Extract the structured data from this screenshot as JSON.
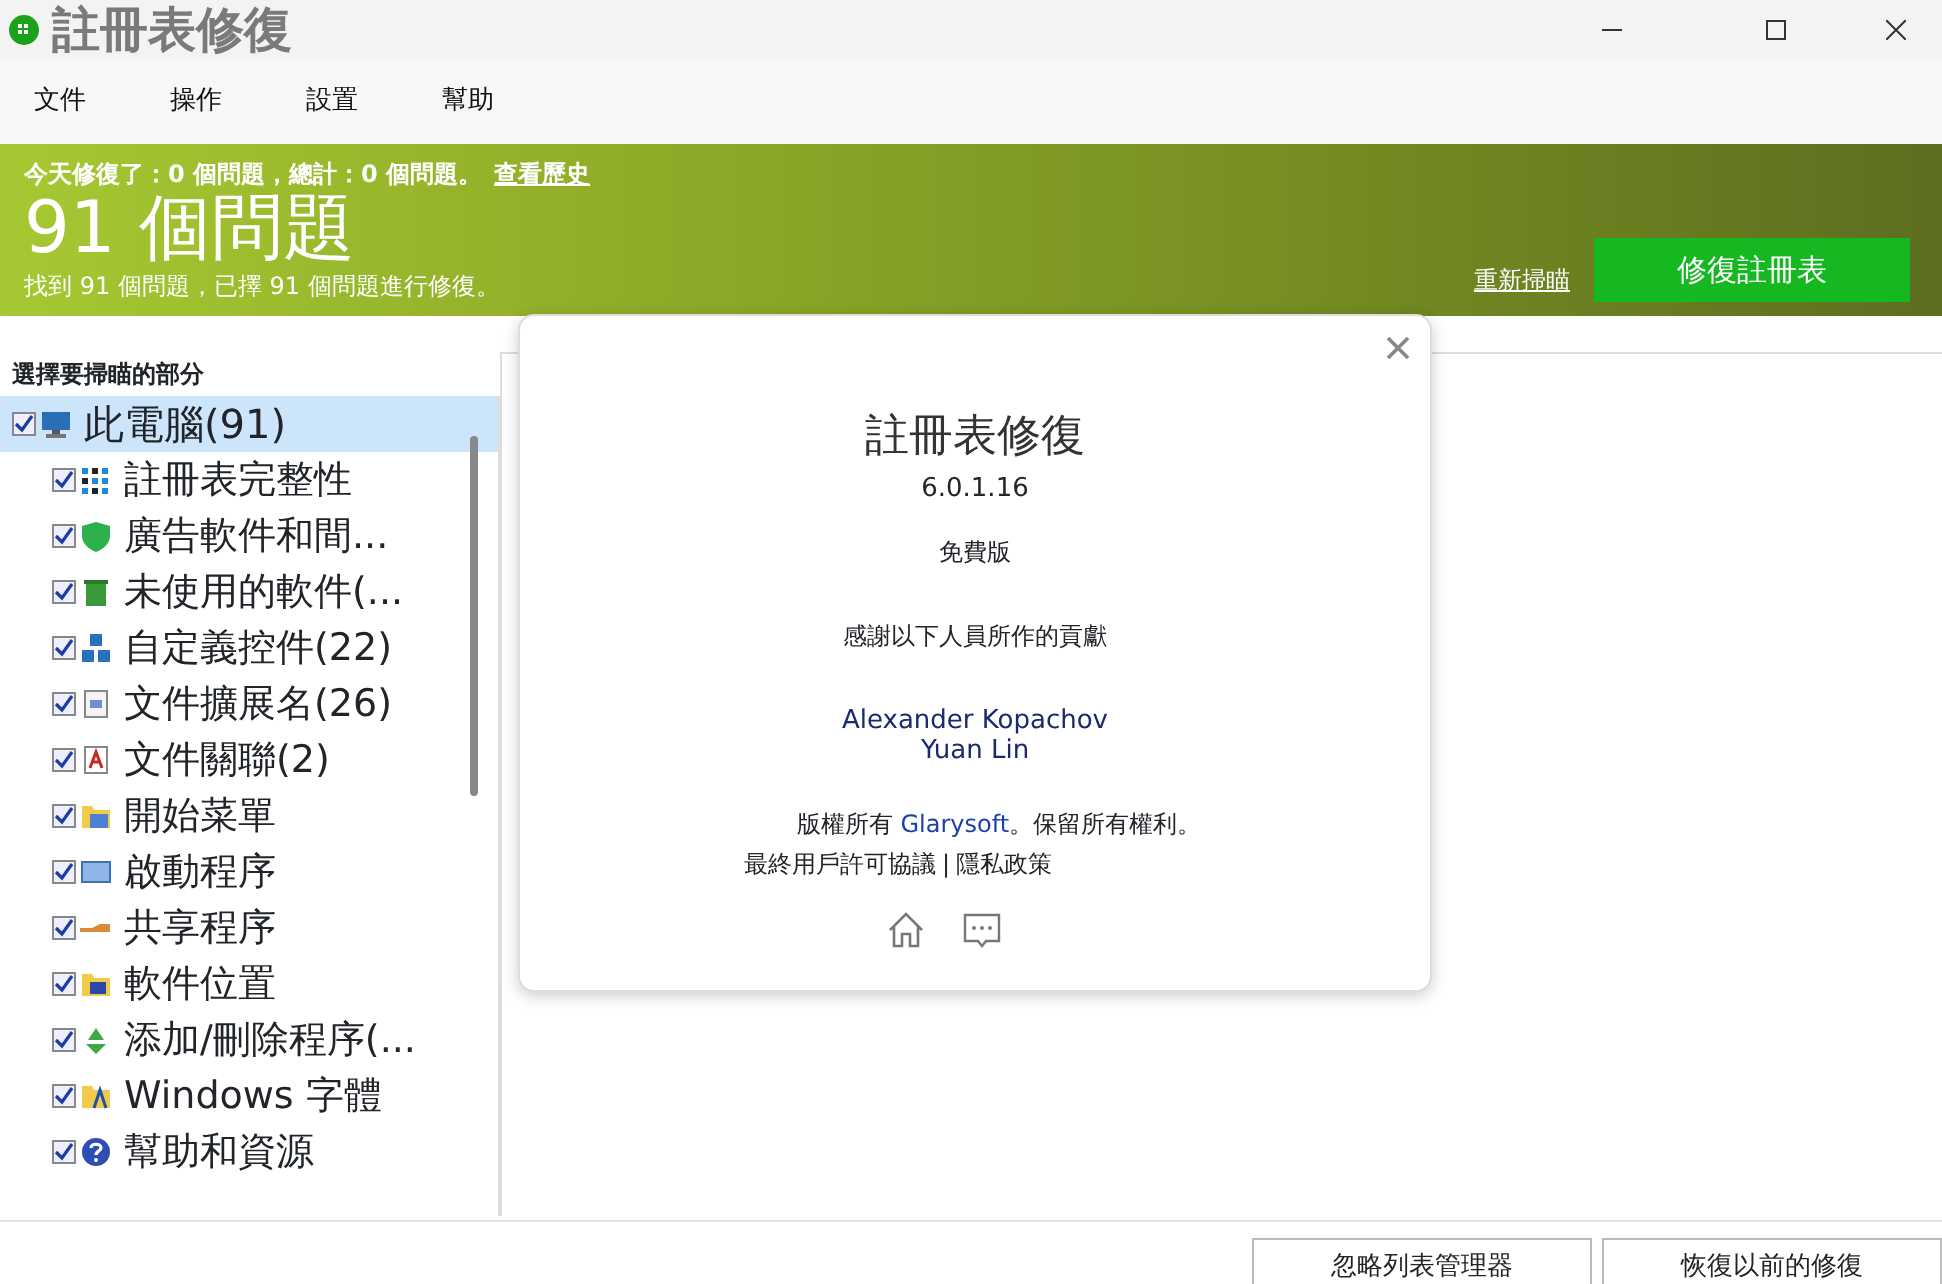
{
  "window": {
    "title": "註冊表修復"
  },
  "menu": [
    {
      "label": "文件"
    },
    {
      "label": "操作"
    },
    {
      "label": "設置"
    },
    {
      "label": "幫助"
    }
  ],
  "banner": {
    "today": "今天修復了：0 個問題，總計：0 個問題。",
    "history_link": "查看歷史",
    "headline": "91 個問題",
    "summary": "找到 91 個問題，已擇 91 個問題進行修復。",
    "rescan_link": "重新掃瞄",
    "repair_button": "修復註冊表"
  },
  "sidebar": {
    "heading": "選擇要掃瞄的部分",
    "tree": [
      {
        "label": "此電腦(91)",
        "checked": true,
        "selected": true,
        "children": [
          {
            "label": "註冊表完整性",
            "checked": true,
            "selected": false
          },
          {
            "label": "廣告軟件和間...",
            "checked": true,
            "selected": false
          },
          {
            "label": "未使用的軟件(...",
            "checked": true,
            "selected": false
          },
          {
            "label": "自定義控件(22)",
            "checked": true,
            "selected": false
          },
          {
            "label": "文件擴展名(26)",
            "checked": true,
            "selected": false
          },
          {
            "label": "文件關聯(2)",
            "checked": true,
            "selected": false
          },
          {
            "label": "開始菜單",
            "checked": true,
            "selected": false
          },
          {
            "label": "啟動程序",
            "checked": true,
            "selected": false
          },
          {
            "label": "共享程序",
            "checked": true,
            "selected": false
          },
          {
            "label": "軟件位置",
            "checked": true,
            "selected": false
          },
          {
            "label": "添加/刪除程序(...",
            "checked": true,
            "selected": false
          },
          {
            "label": "Windows 字體",
            "checked": true,
            "selected": false
          },
          {
            "label": "幫助和資源",
            "checked": true,
            "selected": false
          }
        ]
      }
    ]
  },
  "about_dialog": {
    "title": "註冊表修復",
    "version": "6.0.1.16",
    "edition": "免費版",
    "thanks": "感謝以下人員所作的貢獻",
    "credits": [
      "Alexander Kopachov",
      "Yuan Lin"
    ],
    "copyright_prefix": "版權所有 ",
    "company": "Glarysoft",
    "copyright_suffix": "。保留所有權利。",
    "eula_link": "最終用戶許可協議",
    "separator": "|",
    "privacy_link": "隱私政策"
  },
  "footer": {
    "buttons": [
      "忽略列表管理器",
      "恢復以前的修復"
    ]
  }
}
